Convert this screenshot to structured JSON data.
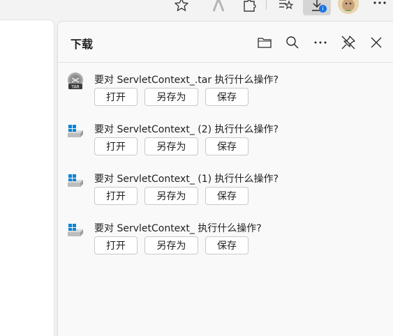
{
  "browser_toolbar": {
    "icons": [
      "star-icon",
      "read-aloud-icon",
      "extensions-icon",
      "favorites-icon",
      "downloads-icon",
      "profile-avatar",
      "more-icon"
    ],
    "download_badge": "i"
  },
  "panel": {
    "title": "下载",
    "header_icons": [
      "folder-icon",
      "search-icon",
      "more-options-icon",
      "pin-icon",
      "close-icon"
    ]
  },
  "downloads": [
    {
      "file_type": "tar",
      "type_badge": "TAR",
      "message": "要对 ServletContext_.tar 执行什么操作?",
      "open_label": "打开",
      "saveas_label": "另存为",
      "save_label": "保存"
    },
    {
      "file_type": "windows",
      "message": "要对 ServletContext_ (2) 执行什么操作?",
      "open_label": "打开",
      "saveas_label": "另存为",
      "save_label": "保存"
    },
    {
      "file_type": "windows",
      "message": "要对 ServletContext_ (1) 执行什么操作?",
      "open_label": "打开",
      "saveas_label": "另存为",
      "save_label": "保存"
    },
    {
      "file_type": "windows",
      "message": "要对 ServletContext_ 执行什么操作?",
      "open_label": "打开",
      "saveas_label": "另存为",
      "save_label": "保存"
    }
  ],
  "colors": {
    "accent": "#1a73e8",
    "panel_bg": "#f9f9f9",
    "windows_blue": "#0a84d8"
  }
}
